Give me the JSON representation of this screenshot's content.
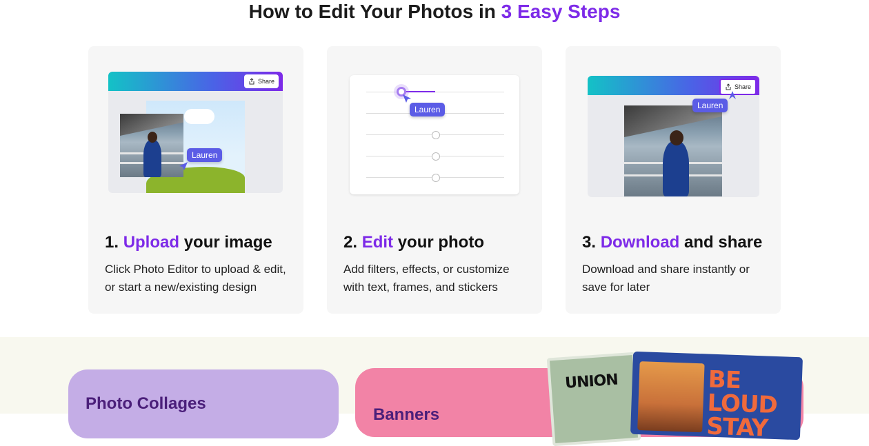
{
  "header": {
    "title_prefix": "How to Edit Your Photos in ",
    "title_accent": "3 Easy Steps"
  },
  "steps": [
    {
      "number": "1.",
      "accent": "Upload",
      "rest": "your image",
      "description": "Click Photo Editor to upload & edit, or start a new/existing design",
      "art": {
        "share_label": "Share",
        "tag": "Lauren"
      }
    },
    {
      "number": "2.",
      "accent": "Edit",
      "rest": "your photo",
      "description": "Add filters, effects, or customize with text, frames, and stickers",
      "art": {
        "tag": "Lauren"
      }
    },
    {
      "number": "3.",
      "accent": "Download",
      "rest": "and share",
      "description": "Download and share instantly or save for later",
      "art": {
        "share_label": "Share",
        "tag": "Lauren"
      }
    }
  ],
  "categories": [
    {
      "label": "Photo Collages"
    },
    {
      "label": "Banners"
    }
  ],
  "posters": {
    "green_text": "UNION",
    "blue_text_line1": "BE LOUD",
    "blue_text_line2": "STAY"
  },
  "colors": {
    "accent": "#7d2ae8",
    "tag": "#5b5ce6",
    "card_bg": "#f6f6f6",
    "collage_tile": "#c4ade6",
    "banner_tile": "#f283a6"
  }
}
